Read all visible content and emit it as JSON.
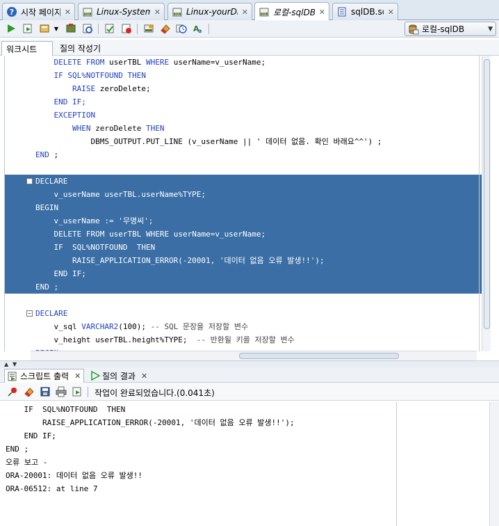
{
  "tabs": [
    {
      "label": "시작 페이지",
      "icon": "help-icon",
      "italic": false,
      "active": false
    },
    {
      "label": "Linux-System",
      "icon": "sql-worksheet-icon",
      "italic": true,
      "active": false
    },
    {
      "label": "Linux-yourDB",
      "icon": "sql-worksheet-icon",
      "italic": true,
      "active": false
    },
    {
      "label": "로컬-sqlDB",
      "icon": "sql-worksheet-icon",
      "italic": true,
      "active": true
    },
    {
      "label": "sqlDB.sql",
      "icon": "file-icon",
      "italic": false,
      "active": false
    }
  ],
  "toolbar": {
    "connection": "로컬-sqlDB"
  },
  "subtabs": {
    "worksheet": "워크시트",
    "query_builder": "질의 작성기"
  },
  "editor": {
    "lines": [
      {
        "t": [
          [
            "    ",
            ""
          ],
          [
            "DELETE FROM",
            "kw"
          ],
          [
            " userTBL ",
            ""
          ],
          [
            "WHERE",
            "kw"
          ],
          [
            " userName=v_userName;",
            ""
          ]
        ],
        "sel": false,
        "fold": false
      },
      {
        "t": [
          [
            "    ",
            ""
          ],
          [
            "IF SQL%NOTFOUND THEN",
            "kw"
          ]
        ],
        "sel": false,
        "fold": false
      },
      {
        "t": [
          [
            "        ",
            ""
          ],
          [
            "RAISE",
            "kw"
          ],
          [
            " zeroDelete;",
            ""
          ]
        ],
        "sel": false,
        "fold": false
      },
      {
        "t": [
          [
            "    ",
            ""
          ],
          [
            "END IF;",
            "kw"
          ]
        ],
        "sel": false,
        "fold": false
      },
      {
        "t": [
          [
            "    ",
            ""
          ],
          [
            "EXCEPTION",
            "kw"
          ]
        ],
        "sel": false,
        "fold": false
      },
      {
        "t": [
          [
            "        ",
            ""
          ],
          [
            "WHEN",
            "kw"
          ],
          [
            " zeroDelete ",
            ""
          ],
          [
            "THEN",
            "kw"
          ]
        ],
        "sel": false,
        "fold": false
      },
      {
        "t": [
          [
            "            DBMS_OUTPUT.PUT_LINE (v_userName || ' 데이터 없음. 확인 바래요^^') ;",
            ""
          ]
        ],
        "sel": false,
        "fold": false
      },
      {
        "t": [
          [
            "END",
            "kw"
          ],
          [
            " ;",
            ""
          ]
        ],
        "sel": false,
        "fold": false
      },
      {
        "t": [
          [
            "",
            ""
          ]
        ],
        "sel": false,
        "fold": false
      },
      {
        "t": [
          [
            "DECLARE",
            "kw"
          ]
        ],
        "sel": true,
        "fold": true
      },
      {
        "t": [
          [
            "    v_userName userTBL.userName%TYPE;",
            ""
          ]
        ],
        "sel": true,
        "fold": false
      },
      {
        "t": [
          [
            "BEGIN",
            "kw"
          ]
        ],
        "sel": true,
        "fold": false
      },
      {
        "t": [
          [
            "    v_userName := '무명씨';",
            ""
          ]
        ],
        "sel": true,
        "fold": false
      },
      {
        "t": [
          [
            "    ",
            ""
          ],
          [
            "DELETE FROM",
            "kw"
          ],
          [
            " userTBL ",
            ""
          ],
          [
            "WHERE",
            "kw"
          ],
          [
            " userName=v_userName;",
            ""
          ]
        ],
        "sel": true,
        "fold": false
      },
      {
        "t": [
          [
            "    ",
            ""
          ],
          [
            "IF  SQL%NOTFOUND  THEN",
            "kw"
          ]
        ],
        "sel": true,
        "fold": false
      },
      {
        "t": [
          [
            "        RAISE_APPLICATION_ERROR(-20001, '데이터 없음 오류 발생!!');",
            ""
          ]
        ],
        "sel": true,
        "fold": false
      },
      {
        "t": [
          [
            "    ",
            ""
          ],
          [
            "END IF;",
            "kw"
          ]
        ],
        "sel": true,
        "fold": false
      },
      {
        "t": [
          [
            "END",
            "kw"
          ],
          [
            " ;",
            ""
          ]
        ],
        "sel": true,
        "fold": false
      },
      {
        "t": [
          [
            "",
            ""
          ]
        ],
        "sel": false,
        "fold": false
      },
      {
        "t": [
          [
            "DECLARE",
            "kw"
          ]
        ],
        "sel": false,
        "fold": true
      },
      {
        "t": [
          [
            "    v_sql ",
            ""
          ],
          [
            "VARCHAR2",
            "kw"
          ],
          [
            "(100); ",
            ""
          ],
          [
            "-- SQL 문장을 저장할 변수",
            "cm"
          ]
        ],
        "sel": false,
        "fold": false
      },
      {
        "t": [
          [
            "    v_height userTBL.height%TYPE;  ",
            ""
          ],
          [
            "-- 반환될 키를 저장할 변수",
            "cm"
          ]
        ],
        "sel": false,
        "fold": false
      },
      {
        "t": [
          [
            "BEGIN",
            "kw"
          ]
        ],
        "sel": false,
        "fold": false
      }
    ]
  },
  "output_tabs": {
    "script_output": "스크립트 출력",
    "query_result": "질의 결과"
  },
  "output": {
    "status": "작업이 완료되었습니다.(0.041초)",
    "lines": [
      "    IF  SQL%NOTFOUND  THEN",
      "        RAISE_APPLICATION_ERROR(-20001, '데이터 없음 오류 발생!!');",
      "    END IF;",
      "END ;",
      "오류 보고 -",
      "ORA-20001: 데이터 없음 오류 발생!!",
      "ORA-06512: at line 7"
    ]
  },
  "colors": {
    "selection": "#3a6ea5",
    "keyword": "#1f3fbf"
  }
}
